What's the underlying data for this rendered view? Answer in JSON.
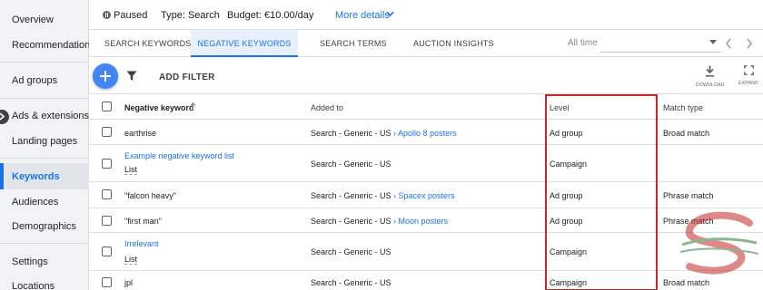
{
  "sidebar": {
    "items": [
      {
        "label": "Overview"
      },
      {
        "label": "Recommendations"
      },
      {
        "label": "Ad groups"
      },
      {
        "label": "Ads & extensions"
      },
      {
        "label": "Landing pages"
      },
      {
        "label": "Keywords"
      },
      {
        "label": "Audiences"
      },
      {
        "label": "Demographics"
      },
      {
        "label": "Settings"
      },
      {
        "label": "Locations"
      }
    ],
    "active_label": "Keywords"
  },
  "status": {
    "state": "Paused",
    "type": "Type: Search",
    "budget": "Budget: €10.00/day",
    "more_details": "More details"
  },
  "tabs": [
    {
      "label": "SEARCH KEYWORDS",
      "active": false
    },
    {
      "label": "NEGATIVE KEYWORDS",
      "active": true
    },
    {
      "label": "SEARCH TERMS",
      "active": false
    },
    {
      "label": "AUCTION INSIGHTS",
      "active": false
    }
  ],
  "date_range": {
    "label": "All time"
  },
  "toolbar": {
    "add_filter": "ADD FILTER",
    "download": "DOWNLOAD",
    "expand": "EXPAND"
  },
  "table": {
    "headers": {
      "keyword": "Negative keyword",
      "added_to": "Added to",
      "level": "Level",
      "match_type": "Match type"
    },
    "rows": [
      {
        "keyword": "earthrise",
        "keyword_link": false,
        "keyword_sub": "",
        "added_to": "Search - Generic - US",
        "added_to_link": "Apollo 8 posters",
        "level": "Ad group",
        "match_type": "Broad match"
      },
      {
        "keyword": "Example negative keyword list",
        "keyword_link": true,
        "keyword_sub": "List",
        "added_to": "Search - Generic - US",
        "added_to_link": "",
        "level": "Campaign",
        "match_type": ""
      },
      {
        "keyword": "\"falcon heavy\"",
        "keyword_link": false,
        "keyword_sub": "",
        "added_to": "Search - Generic - US",
        "added_to_link": "Spacex posters",
        "level": "Ad group",
        "match_type": "Phrase match"
      },
      {
        "keyword": "\"first man\"",
        "keyword_link": false,
        "keyword_sub": "",
        "added_to": "Search - Generic - US",
        "added_to_link": "Moon posters",
        "level": "Ad group",
        "match_type": "Phrase match"
      },
      {
        "keyword": "Irrelevant",
        "keyword_link": true,
        "keyword_sub": "List",
        "added_to": "Search - Generic - US",
        "added_to_link": "",
        "level": "Campaign",
        "match_type": ""
      },
      {
        "keyword": "jpl",
        "keyword_link": false,
        "keyword_sub": "",
        "added_to": "Search - Generic - US",
        "added_to_link": "",
        "level": "Campaign",
        "match_type": "Broad match"
      }
    ]
  },
  "colors": {
    "accent": "#1a73e8",
    "fab": "#4285f4",
    "highlight": "#c62828",
    "sidebar_bg": "#f1f3f4"
  },
  "icons": [
    "pause-icon",
    "chevron-down-icon",
    "plus-icon",
    "filter-icon",
    "download-icon",
    "expand-icon",
    "chevron-left-icon",
    "chevron-right-icon",
    "sort-arrow-icon",
    "sidebar-toggle-icon",
    "dropdown-icon"
  ]
}
